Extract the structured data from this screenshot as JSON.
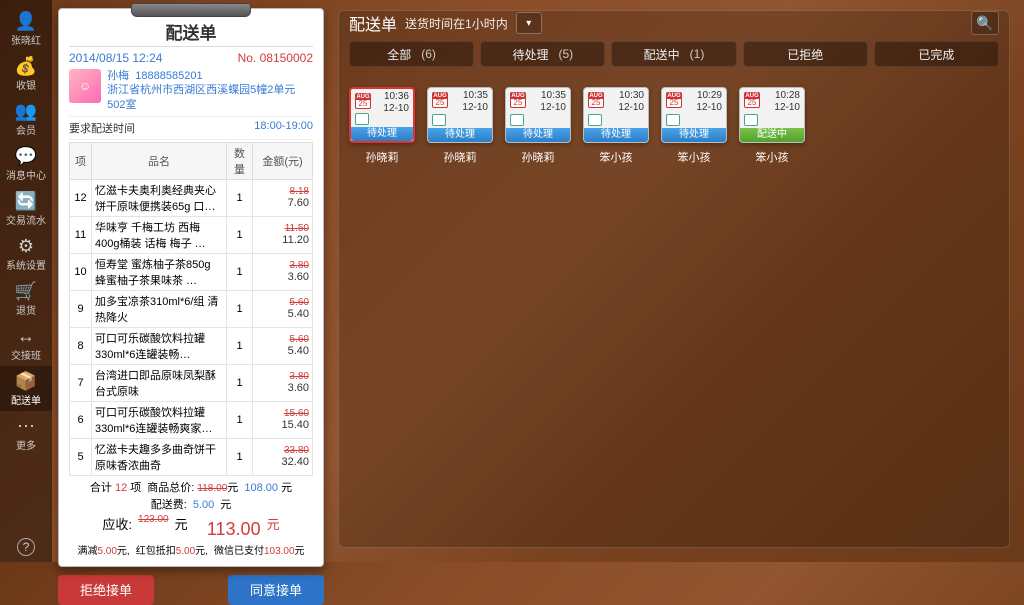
{
  "sidebar": {
    "items": [
      {
        "icon": "👤",
        "label": "张晓红"
      },
      {
        "icon": "💰",
        "label": "收银"
      },
      {
        "icon": "👥",
        "label": "会员"
      },
      {
        "icon": "💬",
        "label": "消息中心"
      },
      {
        "icon": "🔄",
        "label": "交易流水"
      },
      {
        "icon": "⚙",
        "label": "系统设置"
      },
      {
        "icon": "🛒",
        "label": "退货"
      },
      {
        "icon": "↔",
        "label": "交接班"
      },
      {
        "icon": "📦",
        "label": "配送单"
      },
      {
        "icon": "⋯",
        "label": "更多"
      }
    ],
    "help_icon": "?"
  },
  "ticket": {
    "title": "配送单",
    "datetime": "2014/08/15 12:24",
    "order_no_label": "No.",
    "order_no": "08150002",
    "customer_name": "孙梅",
    "customer_phone": "18888585201",
    "customer_addr": "浙江省杭州市西湖区西溪蝶园5幢2单元502室",
    "deliv_label": "要求配送时间",
    "deliv_time": "18:00-19:00",
    "headers": {
      "idx": "项",
      "name": "品名",
      "qty": "数量",
      "amt": "金额(元)"
    },
    "items": [
      {
        "idx": "12",
        "name": "忆滋卡夫奥利奥经典夹心饼干原味便携装65g 口…",
        "qty": "1",
        "old": "8.18",
        "now": "7.60"
      },
      {
        "idx": "11",
        "name": "华味亨 千梅工坊 西梅 400g桶装 话梅 梅子 …",
        "qty": "1",
        "old": "11.50",
        "now": "11.20"
      },
      {
        "idx": "10",
        "name": "恒寿堂 蜜炼柚子茶850g 蜂蜜柚子茶果味茶 …",
        "qty": "1",
        "old": "3.80",
        "now": "3.60"
      },
      {
        "idx": "9",
        "name": "加多宝凉茶310ml*6/组 清热降火",
        "qty": "1",
        "old": "5.60",
        "now": "5.40"
      },
      {
        "idx": "8",
        "name": "可口可乐碳酸饮料拉罐330ml*6连罐装畅…",
        "qty": "1",
        "old": "5.60",
        "now": "5.40"
      },
      {
        "idx": "7",
        "name": "台湾进口即品原味凤梨酥 台式原味",
        "qty": "1",
        "old": "3.80",
        "now": "3.60"
      },
      {
        "idx": "6",
        "name": "可口可乐碳酸饮料拉罐330ml*6连罐装畅爽家…",
        "qty": "1",
        "old": "15.60",
        "now": "15.40"
      },
      {
        "idx": "5",
        "name": "忆滋卡夫趣多多曲奇饼干 原味香浓曲奇",
        "qty": "1",
        "old": "33.80",
        "now": "32.40"
      }
    ],
    "totals": {
      "count_label": "合计",
      "count": "12",
      "count_unit": "项",
      "sum_label": "商品总价:",
      "sum_old": "118.00",
      "sum": "108.00",
      "unit": "元",
      "ship_label": "配送费:",
      "ship": "5.00",
      "due_label": "应收:",
      "due_old": "123.00",
      "due": "113.00",
      "note_a": "满减",
      "note_a_v": "5.00",
      "note_a_u": "元,",
      "note_b": "红包抵扣",
      "note_b_v": "5.00",
      "note_b_u": "元,",
      "note_c": "微信已支付",
      "note_c_v": "103.00",
      "note_c_u": "元"
    },
    "btn_reject": "拒绝接单",
    "btn_accept": "同意接单"
  },
  "main": {
    "title": "配送单",
    "subtitle": "送货时间在1小时内",
    "tabs": [
      {
        "label": "全部",
        "count": "(6)"
      },
      {
        "label": "待处理",
        "count": "(5)"
      },
      {
        "label": "配送中",
        "count": "(1)"
      },
      {
        "label": "已拒绝",
        "count": ""
      },
      {
        "label": "已完成",
        "count": ""
      }
    ],
    "cal_month": "AUG",
    "cal_day": "25",
    "status_pending": "待处理",
    "status_dispatch": "配送中",
    "cards": [
      {
        "time": "10:36",
        "date": "12-10",
        "status": "pending",
        "name": "孙晓莉",
        "selected": true
      },
      {
        "time": "10:35",
        "date": "12-10",
        "status": "pending",
        "name": "孙晓莉"
      },
      {
        "time": "10:35",
        "date": "12-10",
        "status": "pending",
        "name": "孙晓莉"
      },
      {
        "time": "10:30",
        "date": "12-10",
        "status": "pending",
        "name": "笨小孩"
      },
      {
        "time": "10:29",
        "date": "12-10",
        "status": "pending",
        "name": "笨小孩"
      },
      {
        "time": "10:28",
        "date": "12-10",
        "status": "dispatch",
        "name": "笨小孩"
      }
    ]
  }
}
